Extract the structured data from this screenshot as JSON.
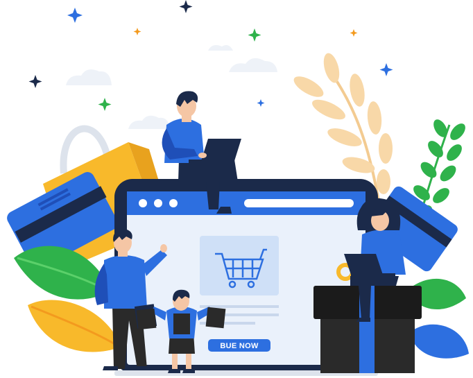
{
  "illustration": {
    "buy_button_label": "BUE NOW"
  },
  "colors": {
    "primary_blue": "#2D6FE0",
    "dark_blue": "#1F4FB8",
    "navy": "#1B2A4A",
    "yellow": "#F8B92B",
    "orange": "#F39A1E",
    "green": "#2FB24B",
    "light_green": "#5BD06A",
    "peach": "#F8D8A8",
    "screen_light": "#EAF1FB",
    "gift_dark": "#2A2A2A"
  },
  "icons": [
    "sparkle-icon",
    "cloud-icon",
    "shopping-cart-icon",
    "laptop-icon",
    "shopping-bag-icon",
    "credit-card-icon",
    "gift-box-icon",
    "leaf-icon"
  ]
}
